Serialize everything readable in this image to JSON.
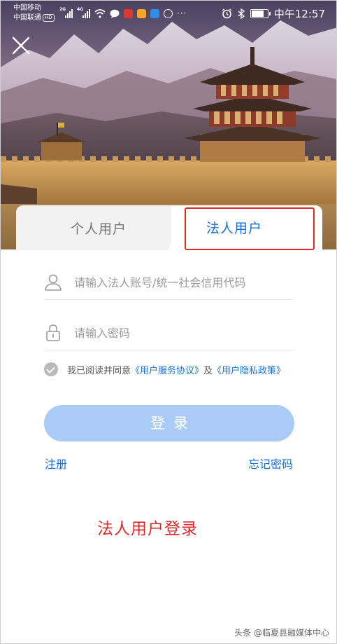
{
  "status_bar": {
    "carrier_1": "中国移动",
    "carrier_2": "中国联通",
    "hd_badge": "HD",
    "net_1": "2G",
    "net_2": "4G",
    "icons": [
      "signal-icon",
      "wifi-icon",
      "message-icon",
      "app-icon",
      "alarm-icon",
      "bluetooth-icon",
      "battery-icon"
    ],
    "time": "中午12:57"
  },
  "header": {
    "close_icon": "close-icon"
  },
  "tabs": {
    "personal": "个人用户",
    "corporate": "法人用户",
    "active": "corporate"
  },
  "form": {
    "account_placeholder": "请输入法人账号/统一社会信用代码",
    "account_value": "",
    "password_placeholder": "请输入密码",
    "password_value": "",
    "agreement_prefix": "我已阅读并同意",
    "service_agreement": "《用户服务协议》",
    "agreement_and": "及",
    "privacy_policy": "《用户隐私政策》",
    "login_button": "登录",
    "register_link": "注册",
    "forgot_link": "忘记密码"
  },
  "annotation": {
    "caption": "法人用户登录"
  },
  "watermark": "头条 @临夏县融媒体中心",
  "colors": {
    "accent": "#1a6fd6",
    "login_button": "#a9cbf5",
    "annotation_red": "#e02a2a",
    "inactive_tab": "#f2f2f2"
  }
}
